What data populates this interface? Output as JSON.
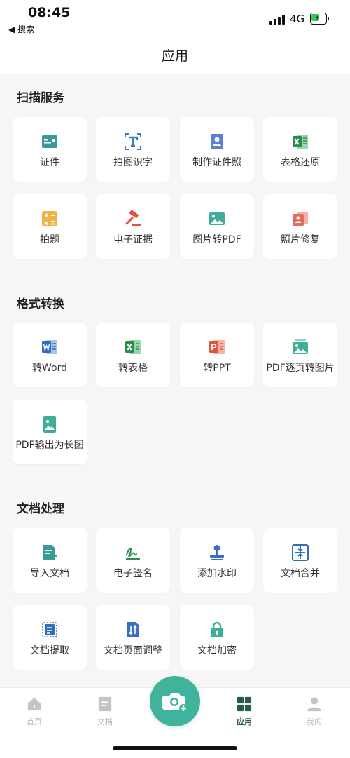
{
  "status": {
    "time": "08:45",
    "back_label": "◀ 搜索",
    "network": "4G"
  },
  "header": {
    "title": "应用"
  },
  "sections": [
    {
      "title": "扫描服务",
      "items": [
        {
          "label": "证件",
          "icon": "id-card-icon"
        },
        {
          "label": "拍图识字",
          "icon": "text-recognition-icon"
        },
        {
          "label": "制作证件照",
          "icon": "id-photo-icon"
        },
        {
          "label": "表格还原",
          "icon": "excel-icon"
        },
        {
          "label": "拍题",
          "icon": "calculator-icon"
        },
        {
          "label": "电子证据",
          "icon": "gavel-icon"
        },
        {
          "label": "图片转PDF",
          "icon": "image-icon"
        },
        {
          "label": "照片修复",
          "icon": "photo-repair-icon"
        }
      ]
    },
    {
      "title": "格式转换",
      "items": [
        {
          "label": "转Word",
          "icon": "word-icon"
        },
        {
          "label": "转表格",
          "icon": "excel-icon"
        },
        {
          "label": "转PPT",
          "icon": "ppt-icon"
        },
        {
          "label": "PDF逐页转图片",
          "icon": "images-icon"
        },
        {
          "label": "PDF输出为长图",
          "icon": "long-image-icon"
        }
      ]
    },
    {
      "title": "文档处理",
      "items": [
        {
          "label": "导入文档",
          "icon": "import-doc-icon"
        },
        {
          "label": "电子签名",
          "icon": "signature-icon"
        },
        {
          "label": "添加水印",
          "icon": "stamp-icon"
        },
        {
          "label": "文档合并",
          "icon": "merge-icon"
        },
        {
          "label": "文档提取",
          "icon": "extract-icon"
        },
        {
          "label": "文档页面调整",
          "icon": "page-adjust-icon"
        },
        {
          "label": "文档加密",
          "icon": "lock-icon"
        }
      ]
    }
  ],
  "tabbar": {
    "items": [
      {
        "label": "首页",
        "icon": "home-icon",
        "active": false
      },
      {
        "label": "文档",
        "icon": "document-icon",
        "active": false
      },
      {
        "label": "应用",
        "icon": "grid-icon",
        "active": true
      },
      {
        "label": "我的",
        "icon": "user-icon",
        "active": false
      }
    ],
    "camera_icon": "camera-plus-icon"
  },
  "colors": {
    "accent": "#3fb39b",
    "active_tab": "#2a5a4f",
    "inactive_tab": "#b5b5b5",
    "background": "#f6f6f6"
  }
}
